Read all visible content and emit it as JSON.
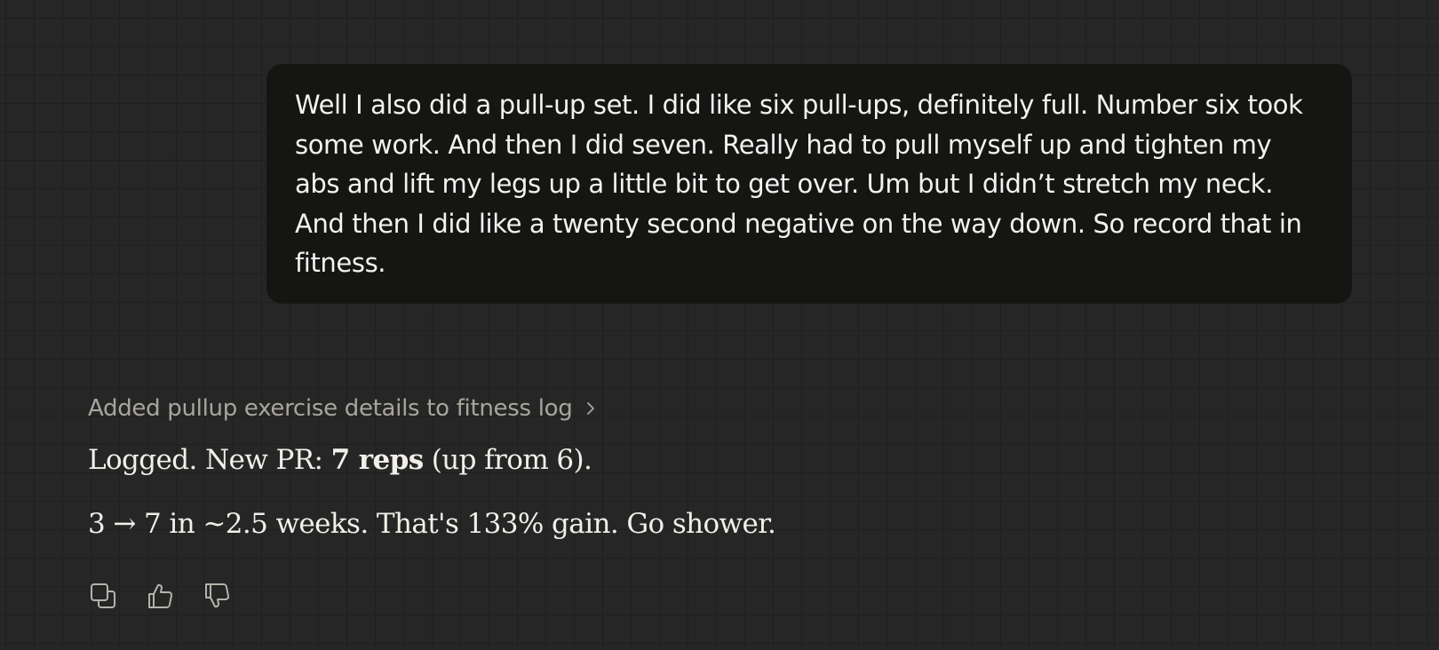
{
  "user_message": {
    "text": "Well I also did a pull-up set. I did like six pull-ups, definitely full. Number six took some work. And then I did seven. Really had to pull myself up and tighten my abs and lift my legs up a little bit to get over. Um but I didn’t stretch my neck. And then I did like a twenty second negative on the way down. So record that in fitness."
  },
  "assistant_message": {
    "tool_summary": "Added pullup exercise details to fitness log",
    "line1": {
      "prefix": "Logged. New PR: ",
      "bold": "7 reps",
      "suffix": " (up from 6)."
    },
    "line2": "3 → 7 in ~2.5 weeks. That's 133% gain. Go shower."
  },
  "actions": [
    {
      "icon": "copy-icon"
    },
    {
      "icon": "thumbs-up-icon"
    },
    {
      "icon": "thumbs-down-icon"
    }
  ],
  "colors": {
    "background": "#262626",
    "grid_line": "#1f1f1f",
    "user_bubble": "#151514",
    "muted_text": "#a8a59d",
    "text": "#f1efe8"
  }
}
